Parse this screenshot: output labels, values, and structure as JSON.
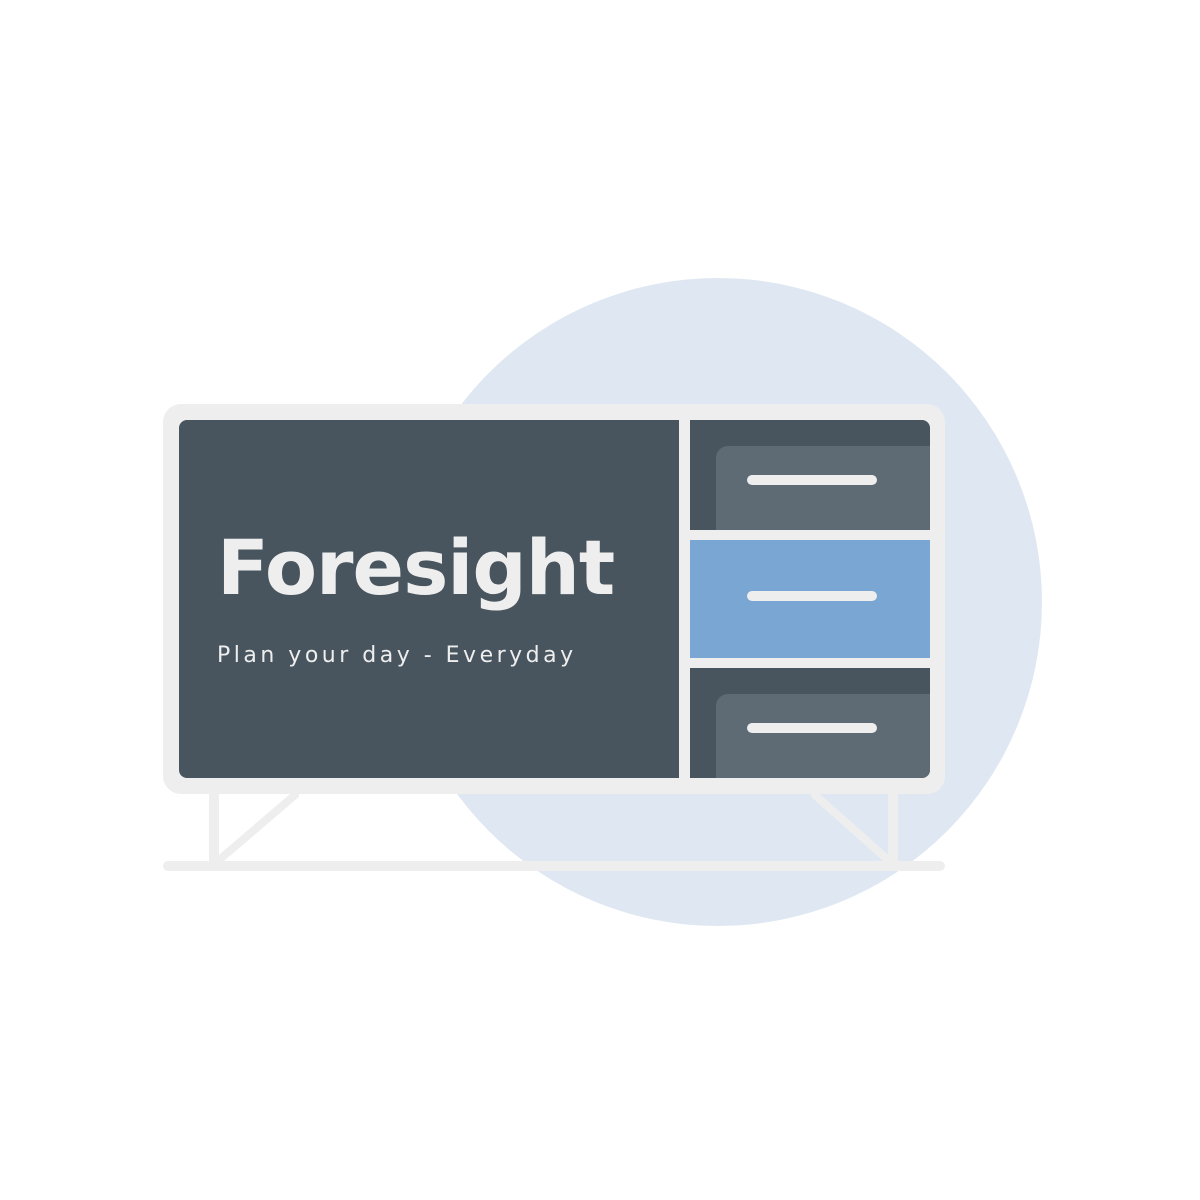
{
  "brand": {
    "name": "Foresight",
    "tagline": "Plan your day - Everyday"
  },
  "colors": {
    "background": "#ffffff",
    "circle": "#dfe8f2",
    "cabinet_frame": "#eeeeee",
    "panel_dark": "#48555f",
    "drawer_face": "#5e6b74",
    "drawer_highlight": "#7aa6d3",
    "text_light": "#eeeeee"
  },
  "drawers": [
    {
      "state": "default"
    },
    {
      "state": "highlighted"
    },
    {
      "state": "default"
    }
  ]
}
